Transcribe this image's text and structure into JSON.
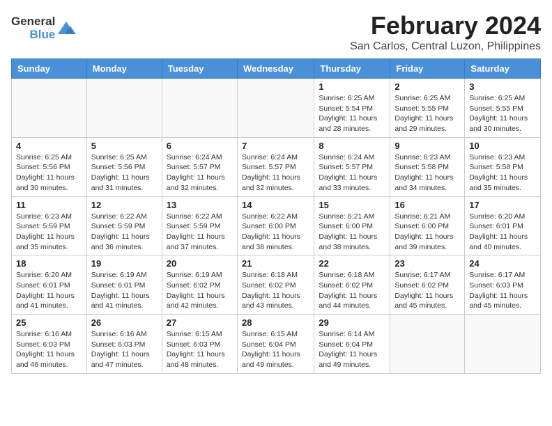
{
  "header": {
    "title": "February 2024",
    "subtitle": "San Carlos, Central Luzon, Philippines"
  },
  "logo": {
    "line1": "General",
    "line2": "Blue"
  },
  "days_of_week": [
    "Sunday",
    "Monday",
    "Tuesday",
    "Wednesday",
    "Thursday",
    "Friday",
    "Saturday"
  ],
  "weeks": [
    [
      {
        "day": "",
        "info": ""
      },
      {
        "day": "",
        "info": ""
      },
      {
        "day": "",
        "info": ""
      },
      {
        "day": "",
        "info": ""
      },
      {
        "day": "1",
        "info": "Sunrise: 6:25 AM\nSunset: 5:54 PM\nDaylight: 11 hours\nand 28 minutes."
      },
      {
        "day": "2",
        "info": "Sunrise: 6:25 AM\nSunset: 5:55 PM\nDaylight: 11 hours\nand 29 minutes."
      },
      {
        "day": "3",
        "info": "Sunrise: 6:25 AM\nSunset: 5:55 PM\nDaylight: 11 hours\nand 30 minutes."
      }
    ],
    [
      {
        "day": "4",
        "info": "Sunrise: 6:25 AM\nSunset: 5:56 PM\nDaylight: 11 hours\nand 30 minutes."
      },
      {
        "day": "5",
        "info": "Sunrise: 6:25 AM\nSunset: 5:56 PM\nDaylight: 11 hours\nand 31 minutes."
      },
      {
        "day": "6",
        "info": "Sunrise: 6:24 AM\nSunset: 5:57 PM\nDaylight: 11 hours\nand 32 minutes."
      },
      {
        "day": "7",
        "info": "Sunrise: 6:24 AM\nSunset: 5:57 PM\nDaylight: 11 hours\nand 32 minutes."
      },
      {
        "day": "8",
        "info": "Sunrise: 6:24 AM\nSunset: 5:57 PM\nDaylight: 11 hours\nand 33 minutes."
      },
      {
        "day": "9",
        "info": "Sunrise: 6:23 AM\nSunset: 5:58 PM\nDaylight: 11 hours\nand 34 minutes."
      },
      {
        "day": "10",
        "info": "Sunrise: 6:23 AM\nSunset: 5:58 PM\nDaylight: 11 hours\nand 35 minutes."
      }
    ],
    [
      {
        "day": "11",
        "info": "Sunrise: 6:23 AM\nSunset: 5:59 PM\nDaylight: 11 hours\nand 35 minutes."
      },
      {
        "day": "12",
        "info": "Sunrise: 6:22 AM\nSunset: 5:59 PM\nDaylight: 11 hours\nand 36 minutes."
      },
      {
        "day": "13",
        "info": "Sunrise: 6:22 AM\nSunset: 5:59 PM\nDaylight: 11 hours\nand 37 minutes."
      },
      {
        "day": "14",
        "info": "Sunrise: 6:22 AM\nSunset: 6:00 PM\nDaylight: 11 hours\nand 38 minutes."
      },
      {
        "day": "15",
        "info": "Sunrise: 6:21 AM\nSunset: 6:00 PM\nDaylight: 11 hours\nand 38 minutes."
      },
      {
        "day": "16",
        "info": "Sunrise: 6:21 AM\nSunset: 6:00 PM\nDaylight: 11 hours\nand 39 minutes."
      },
      {
        "day": "17",
        "info": "Sunrise: 6:20 AM\nSunset: 6:01 PM\nDaylight: 11 hours\nand 40 minutes."
      }
    ],
    [
      {
        "day": "18",
        "info": "Sunrise: 6:20 AM\nSunset: 6:01 PM\nDaylight: 11 hours\nand 41 minutes."
      },
      {
        "day": "19",
        "info": "Sunrise: 6:19 AM\nSunset: 6:01 PM\nDaylight: 11 hours\nand 41 minutes."
      },
      {
        "day": "20",
        "info": "Sunrise: 6:19 AM\nSunset: 6:02 PM\nDaylight: 11 hours\nand 42 minutes."
      },
      {
        "day": "21",
        "info": "Sunrise: 6:18 AM\nSunset: 6:02 PM\nDaylight: 11 hours\nand 43 minutes."
      },
      {
        "day": "22",
        "info": "Sunrise: 6:18 AM\nSunset: 6:02 PM\nDaylight: 11 hours\nand 44 minutes."
      },
      {
        "day": "23",
        "info": "Sunrise: 6:17 AM\nSunset: 6:02 PM\nDaylight: 11 hours\nand 45 minutes."
      },
      {
        "day": "24",
        "info": "Sunrise: 6:17 AM\nSunset: 6:03 PM\nDaylight: 11 hours\nand 45 minutes."
      }
    ],
    [
      {
        "day": "25",
        "info": "Sunrise: 6:16 AM\nSunset: 6:03 PM\nDaylight: 11 hours\nand 46 minutes."
      },
      {
        "day": "26",
        "info": "Sunrise: 6:16 AM\nSunset: 6:03 PM\nDaylight: 11 hours\nand 47 minutes."
      },
      {
        "day": "27",
        "info": "Sunrise: 6:15 AM\nSunset: 6:03 PM\nDaylight: 11 hours\nand 48 minutes."
      },
      {
        "day": "28",
        "info": "Sunrise: 6:15 AM\nSunset: 6:04 PM\nDaylight: 11 hours\nand 49 minutes."
      },
      {
        "day": "29",
        "info": "Sunrise: 6:14 AM\nSunset: 6:04 PM\nDaylight: 11 hours\nand 49 minutes."
      },
      {
        "day": "",
        "info": ""
      },
      {
        "day": "",
        "info": ""
      }
    ]
  ]
}
